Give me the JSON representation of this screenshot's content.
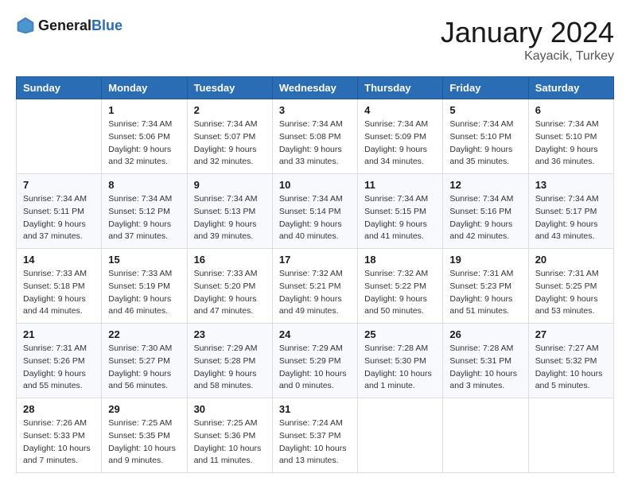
{
  "header": {
    "logo": {
      "general": "General",
      "blue": "Blue"
    },
    "title": "January 2024",
    "location": "Kayacik, Turkey"
  },
  "weekdays": [
    "Sunday",
    "Monday",
    "Tuesday",
    "Wednesday",
    "Thursday",
    "Friday",
    "Saturday"
  ],
  "weeks": [
    [
      {
        "day": "",
        "sunrise": "",
        "sunset": "",
        "daylight": ""
      },
      {
        "day": "1",
        "sunrise": "Sunrise: 7:34 AM",
        "sunset": "Sunset: 5:06 PM",
        "daylight": "Daylight: 9 hours and 32 minutes."
      },
      {
        "day": "2",
        "sunrise": "Sunrise: 7:34 AM",
        "sunset": "Sunset: 5:07 PM",
        "daylight": "Daylight: 9 hours and 32 minutes."
      },
      {
        "day": "3",
        "sunrise": "Sunrise: 7:34 AM",
        "sunset": "Sunset: 5:08 PM",
        "daylight": "Daylight: 9 hours and 33 minutes."
      },
      {
        "day": "4",
        "sunrise": "Sunrise: 7:34 AM",
        "sunset": "Sunset: 5:09 PM",
        "daylight": "Daylight: 9 hours and 34 minutes."
      },
      {
        "day": "5",
        "sunrise": "Sunrise: 7:34 AM",
        "sunset": "Sunset: 5:10 PM",
        "daylight": "Daylight: 9 hours and 35 minutes."
      },
      {
        "day": "6",
        "sunrise": "Sunrise: 7:34 AM",
        "sunset": "Sunset: 5:10 PM",
        "daylight": "Daylight: 9 hours and 36 minutes."
      }
    ],
    [
      {
        "day": "7",
        "sunrise": "Sunrise: 7:34 AM",
        "sunset": "Sunset: 5:11 PM",
        "daylight": "Daylight: 9 hours and 37 minutes."
      },
      {
        "day": "8",
        "sunrise": "Sunrise: 7:34 AM",
        "sunset": "Sunset: 5:12 PM",
        "daylight": "Daylight: 9 hours and 37 minutes."
      },
      {
        "day": "9",
        "sunrise": "Sunrise: 7:34 AM",
        "sunset": "Sunset: 5:13 PM",
        "daylight": "Daylight: 9 hours and 39 minutes."
      },
      {
        "day": "10",
        "sunrise": "Sunrise: 7:34 AM",
        "sunset": "Sunset: 5:14 PM",
        "daylight": "Daylight: 9 hours and 40 minutes."
      },
      {
        "day": "11",
        "sunrise": "Sunrise: 7:34 AM",
        "sunset": "Sunset: 5:15 PM",
        "daylight": "Daylight: 9 hours and 41 minutes."
      },
      {
        "day": "12",
        "sunrise": "Sunrise: 7:34 AM",
        "sunset": "Sunset: 5:16 PM",
        "daylight": "Daylight: 9 hours and 42 minutes."
      },
      {
        "day": "13",
        "sunrise": "Sunrise: 7:34 AM",
        "sunset": "Sunset: 5:17 PM",
        "daylight": "Daylight: 9 hours and 43 minutes."
      }
    ],
    [
      {
        "day": "14",
        "sunrise": "Sunrise: 7:33 AM",
        "sunset": "Sunset: 5:18 PM",
        "daylight": "Daylight: 9 hours and 44 minutes."
      },
      {
        "day": "15",
        "sunrise": "Sunrise: 7:33 AM",
        "sunset": "Sunset: 5:19 PM",
        "daylight": "Daylight: 9 hours and 46 minutes."
      },
      {
        "day": "16",
        "sunrise": "Sunrise: 7:33 AM",
        "sunset": "Sunset: 5:20 PM",
        "daylight": "Daylight: 9 hours and 47 minutes."
      },
      {
        "day": "17",
        "sunrise": "Sunrise: 7:32 AM",
        "sunset": "Sunset: 5:21 PM",
        "daylight": "Daylight: 9 hours and 49 minutes."
      },
      {
        "day": "18",
        "sunrise": "Sunrise: 7:32 AM",
        "sunset": "Sunset: 5:22 PM",
        "daylight": "Daylight: 9 hours and 50 minutes."
      },
      {
        "day": "19",
        "sunrise": "Sunrise: 7:31 AM",
        "sunset": "Sunset: 5:23 PM",
        "daylight": "Daylight: 9 hours and 51 minutes."
      },
      {
        "day": "20",
        "sunrise": "Sunrise: 7:31 AM",
        "sunset": "Sunset: 5:25 PM",
        "daylight": "Daylight: 9 hours and 53 minutes."
      }
    ],
    [
      {
        "day": "21",
        "sunrise": "Sunrise: 7:31 AM",
        "sunset": "Sunset: 5:26 PM",
        "daylight": "Daylight: 9 hours and 55 minutes."
      },
      {
        "day": "22",
        "sunrise": "Sunrise: 7:30 AM",
        "sunset": "Sunset: 5:27 PM",
        "daylight": "Daylight: 9 hours and 56 minutes."
      },
      {
        "day": "23",
        "sunrise": "Sunrise: 7:29 AM",
        "sunset": "Sunset: 5:28 PM",
        "daylight": "Daylight: 9 hours and 58 minutes."
      },
      {
        "day": "24",
        "sunrise": "Sunrise: 7:29 AM",
        "sunset": "Sunset: 5:29 PM",
        "daylight": "Daylight: 10 hours and 0 minutes."
      },
      {
        "day": "25",
        "sunrise": "Sunrise: 7:28 AM",
        "sunset": "Sunset: 5:30 PM",
        "daylight": "Daylight: 10 hours and 1 minute."
      },
      {
        "day": "26",
        "sunrise": "Sunrise: 7:28 AM",
        "sunset": "Sunset: 5:31 PM",
        "daylight": "Daylight: 10 hours and 3 minutes."
      },
      {
        "day": "27",
        "sunrise": "Sunrise: 7:27 AM",
        "sunset": "Sunset: 5:32 PM",
        "daylight": "Daylight: 10 hours and 5 minutes."
      }
    ],
    [
      {
        "day": "28",
        "sunrise": "Sunrise: 7:26 AM",
        "sunset": "Sunset: 5:33 PM",
        "daylight": "Daylight: 10 hours and 7 minutes."
      },
      {
        "day": "29",
        "sunrise": "Sunrise: 7:25 AM",
        "sunset": "Sunset: 5:35 PM",
        "daylight": "Daylight: 10 hours and 9 minutes."
      },
      {
        "day": "30",
        "sunrise": "Sunrise: 7:25 AM",
        "sunset": "Sunset: 5:36 PM",
        "daylight": "Daylight: 10 hours and 11 minutes."
      },
      {
        "day": "31",
        "sunrise": "Sunrise: 7:24 AM",
        "sunset": "Sunset: 5:37 PM",
        "daylight": "Daylight: 10 hours and 13 minutes."
      },
      {
        "day": "",
        "sunrise": "",
        "sunset": "",
        "daylight": ""
      },
      {
        "day": "",
        "sunrise": "",
        "sunset": "",
        "daylight": ""
      },
      {
        "day": "",
        "sunrise": "",
        "sunset": "",
        "daylight": ""
      }
    ]
  ]
}
